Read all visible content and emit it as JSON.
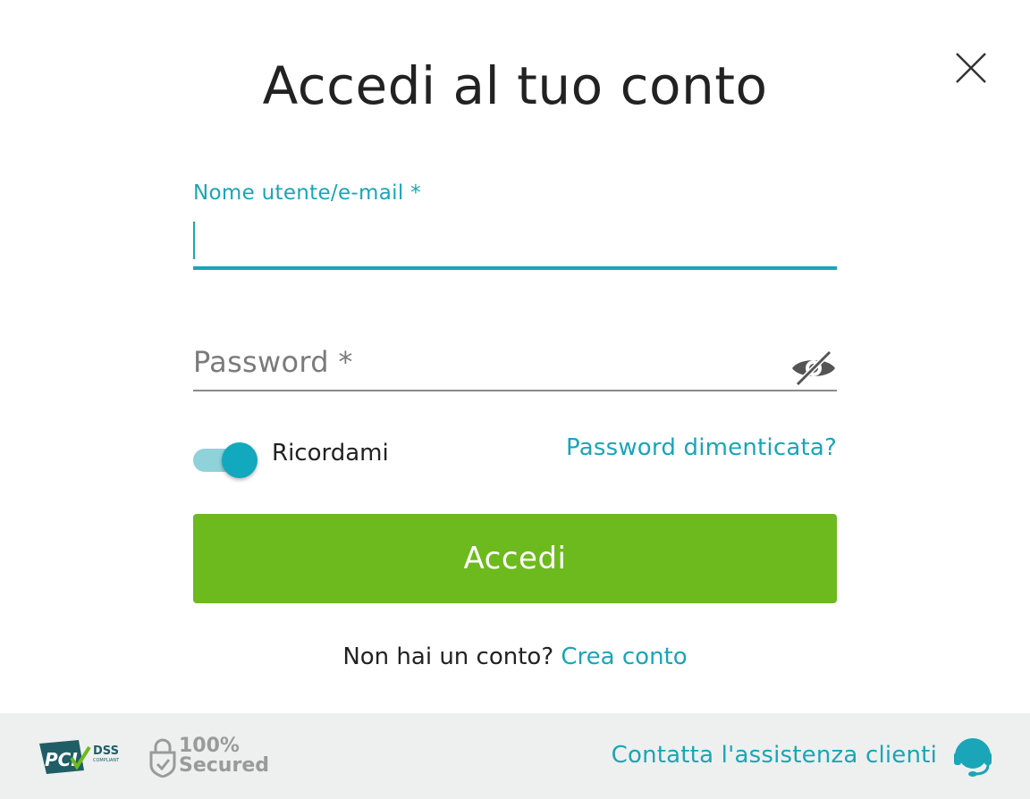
{
  "dialog": {
    "title": "Accedi al tuo conto",
    "close_icon": "close-icon"
  },
  "form": {
    "username": {
      "label": "Nome utente/e-mail *",
      "value": "",
      "placeholder": ""
    },
    "password": {
      "placeholder": "Password *",
      "value": "",
      "visibility_icon": "eye-off-icon"
    },
    "remember": {
      "label": "Ricordami",
      "checked": true
    },
    "forgot_password": "Password dimenticata?",
    "submit_label": "Accedi"
  },
  "signup": {
    "prompt": "Non hai un conto?",
    "link": "Crea conto"
  },
  "footer": {
    "pci_logo": {
      "pci": "PCI",
      "dss": "DSS",
      "compliant": "COMPLIANT"
    },
    "secured_badge": {
      "line1": "100%",
      "line2": "Secured"
    },
    "support_link": "Contatta l'assistenza clienti",
    "support_icon": "headset-icon"
  },
  "colors": {
    "accent": "#1aa5b8",
    "primary_button": "#6dba1e",
    "footer_bg": "#eef0ef",
    "toggle_track": "#8fd2da",
    "toggle_knob": "#12a8bd"
  }
}
